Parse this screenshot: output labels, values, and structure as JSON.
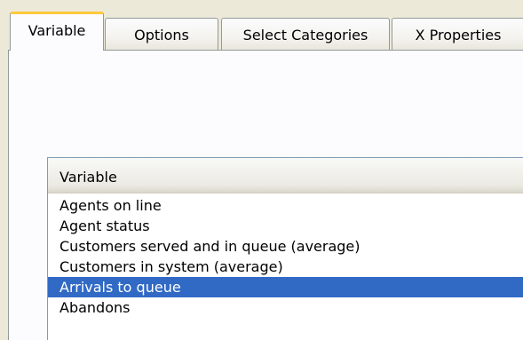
{
  "tabs": [
    {
      "label": "Variable",
      "active": true
    },
    {
      "label": "Options",
      "active": false
    },
    {
      "label": "Select Categories",
      "active": false
    },
    {
      "label": "X Properties",
      "active": false
    }
  ],
  "list": {
    "header": "Variable",
    "rows": [
      {
        "label": "Agents on line",
        "selected": false
      },
      {
        "label": "Agent status",
        "selected": false
      },
      {
        "label": "Customers served and in queue (average)",
        "selected": false
      },
      {
        "label": "Customers in system (average)",
        "selected": false
      },
      {
        "label": "Arrivals to queue",
        "selected": true
      },
      {
        "label": "Abandons",
        "selected": false
      }
    ]
  },
  "colors": {
    "selection": "#316ac5",
    "active_tab_highlight": "#ffc83c",
    "window_background": "#ece9d8"
  }
}
